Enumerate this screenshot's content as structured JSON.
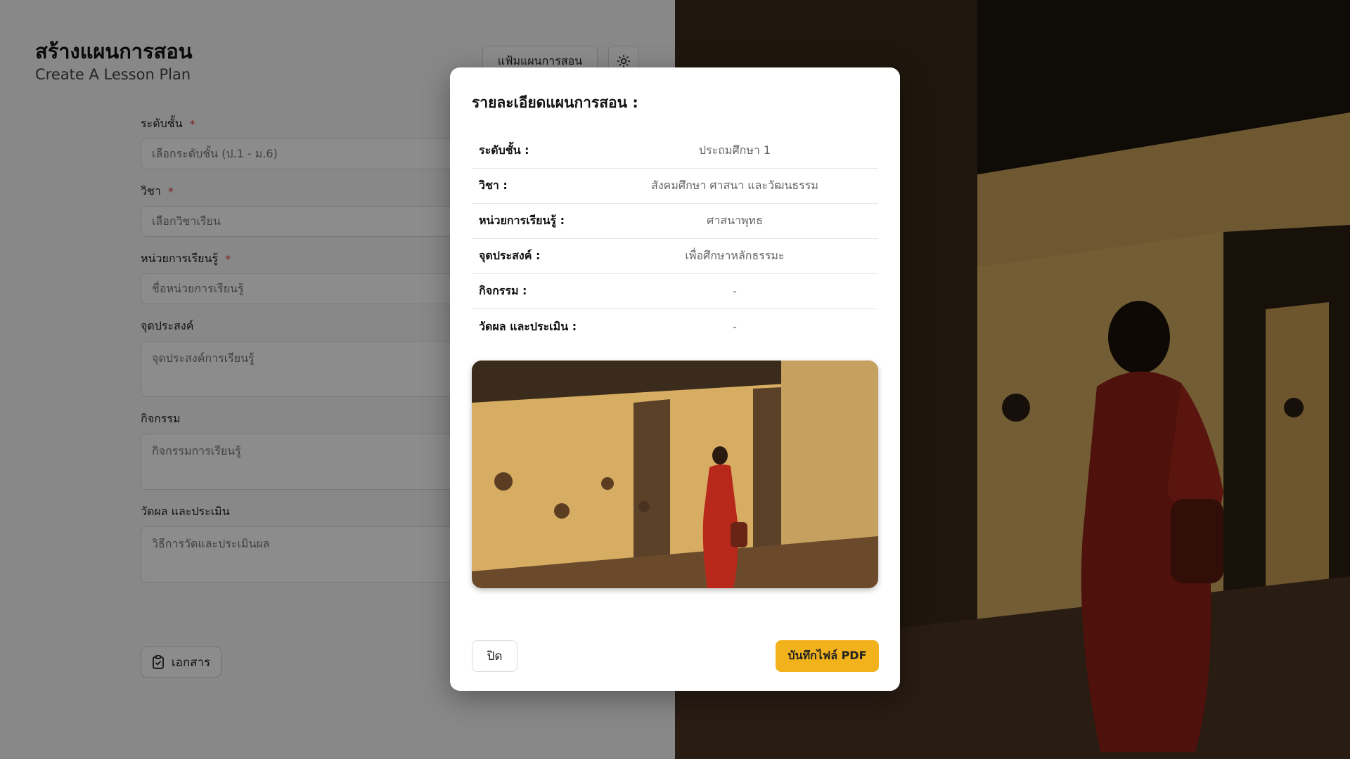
{
  "header": {
    "title": "สร้างแผนการสอน",
    "subtitle": "Create A Lesson Plan",
    "folder_button": "แฟ้มแผนการสอน",
    "theme_icon": "sun-icon"
  },
  "form": {
    "grade": {
      "label": "ระดับชั้น",
      "required": "*",
      "placeholder": "เลือกระดับชั้น (ป.1 - ม.6)"
    },
    "subject": {
      "label": "วิชา",
      "required": "*",
      "placeholder": "เลือกวิชาเรียน"
    },
    "unit": {
      "label": "หน่วยการเรียนรู้",
      "required": "*",
      "placeholder": "ชื่อหน่วยการเรียนรู้"
    },
    "objective": {
      "label": "จุดประสงค์",
      "placeholder": "จุดประสงค์การเรียนรู้"
    },
    "activity": {
      "label": "กิจกรรม",
      "placeholder": "กิจกรรมการเรียนรู้"
    },
    "assessment": {
      "label": "วัดผล และประเมิน",
      "placeholder": "วิธีการวัดและประเมินผล"
    },
    "document_button": "เอกสาร",
    "document_icon": "clipboard-icon"
  },
  "modal": {
    "title": "รายละเอียดแผนการสอน :",
    "rows": [
      {
        "key": "ระดับชั้น :",
        "value": "ประถมศึกษา 1"
      },
      {
        "key": "วิชา :",
        "value": "สังคมศึกษา ศาสนา และวัฒนธรรม"
      },
      {
        "key": "หน่วยการเรียนรู้ :",
        "value": "ศาสนาพุทธ"
      },
      {
        "key": "จุดประสงค์ :",
        "value": "เพื่อศึกษาหลักธรรมะ"
      },
      {
        "key": "กิจกรรม :",
        "value": "-"
      },
      {
        "key": "วัดผล และประเมิน :",
        "value": "-"
      }
    ],
    "close_button": "ปิด",
    "pdf_button": "บันทึกไฟล์ PDF"
  },
  "colors": {
    "accent": "#f2b21c",
    "required": "#e04848",
    "robe": "#b8281a",
    "wall": "#d9b46a"
  }
}
